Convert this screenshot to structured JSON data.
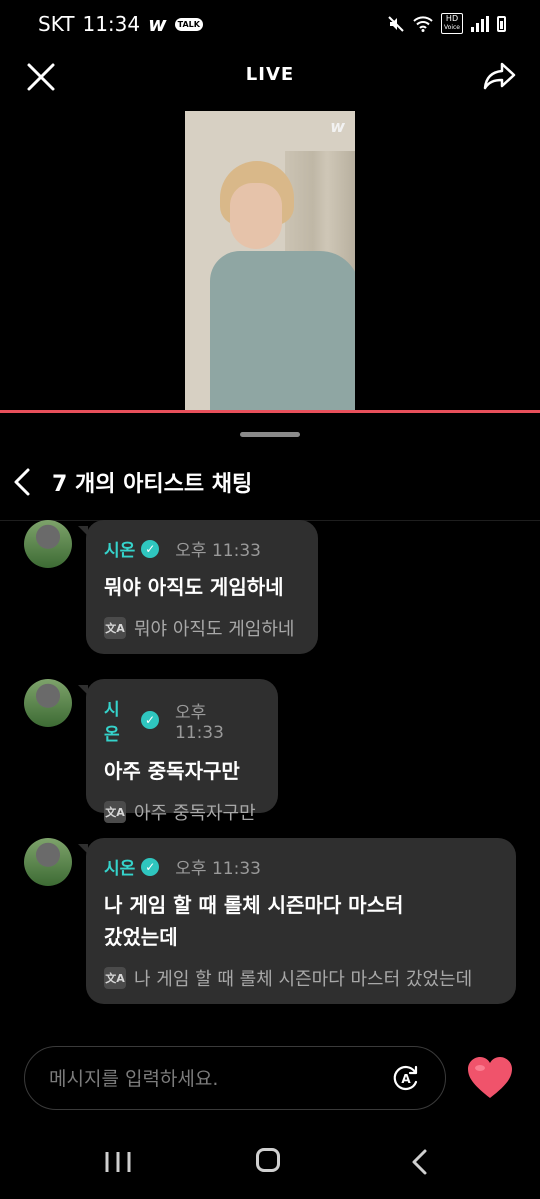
{
  "status_bar": {
    "carrier": "SKT",
    "time": "11:34",
    "app_badge": "w",
    "talk_badge": "TALK",
    "hd_label": "HD",
    "voice_label": "Voice"
  },
  "header": {
    "title": "LIVE"
  },
  "video": {
    "watermark": "w",
    "progress_fraction": 1.0
  },
  "chat": {
    "title": "7 개의 아티스트 채팅",
    "messages": [
      {
        "name": "시온",
        "time": "오후 11:33",
        "text": "뭐야 아직도 게임하네",
        "translation": "뭐야 아직도 게임하네"
      },
      {
        "name": "시온",
        "time": "오후 11:33",
        "text": "아주 중독자구만",
        "translation": "아주 중독자구만"
      },
      {
        "name": "시온",
        "time": "오후 11:33",
        "text": "나 게임 할 때 롤체 시즌마다 마스터\n갔었는데",
        "translation": "나 게임 할 때 롤체 시즌마다 마스터 갔었는데"
      }
    ],
    "verified_mark": "✓",
    "translate_icon_label": "文A"
  },
  "composer": {
    "placeholder": "메시지를 입력하세요."
  },
  "colors": {
    "accent": "#35d3cb",
    "progress": "#e8505b",
    "heart": "#f0536b"
  }
}
